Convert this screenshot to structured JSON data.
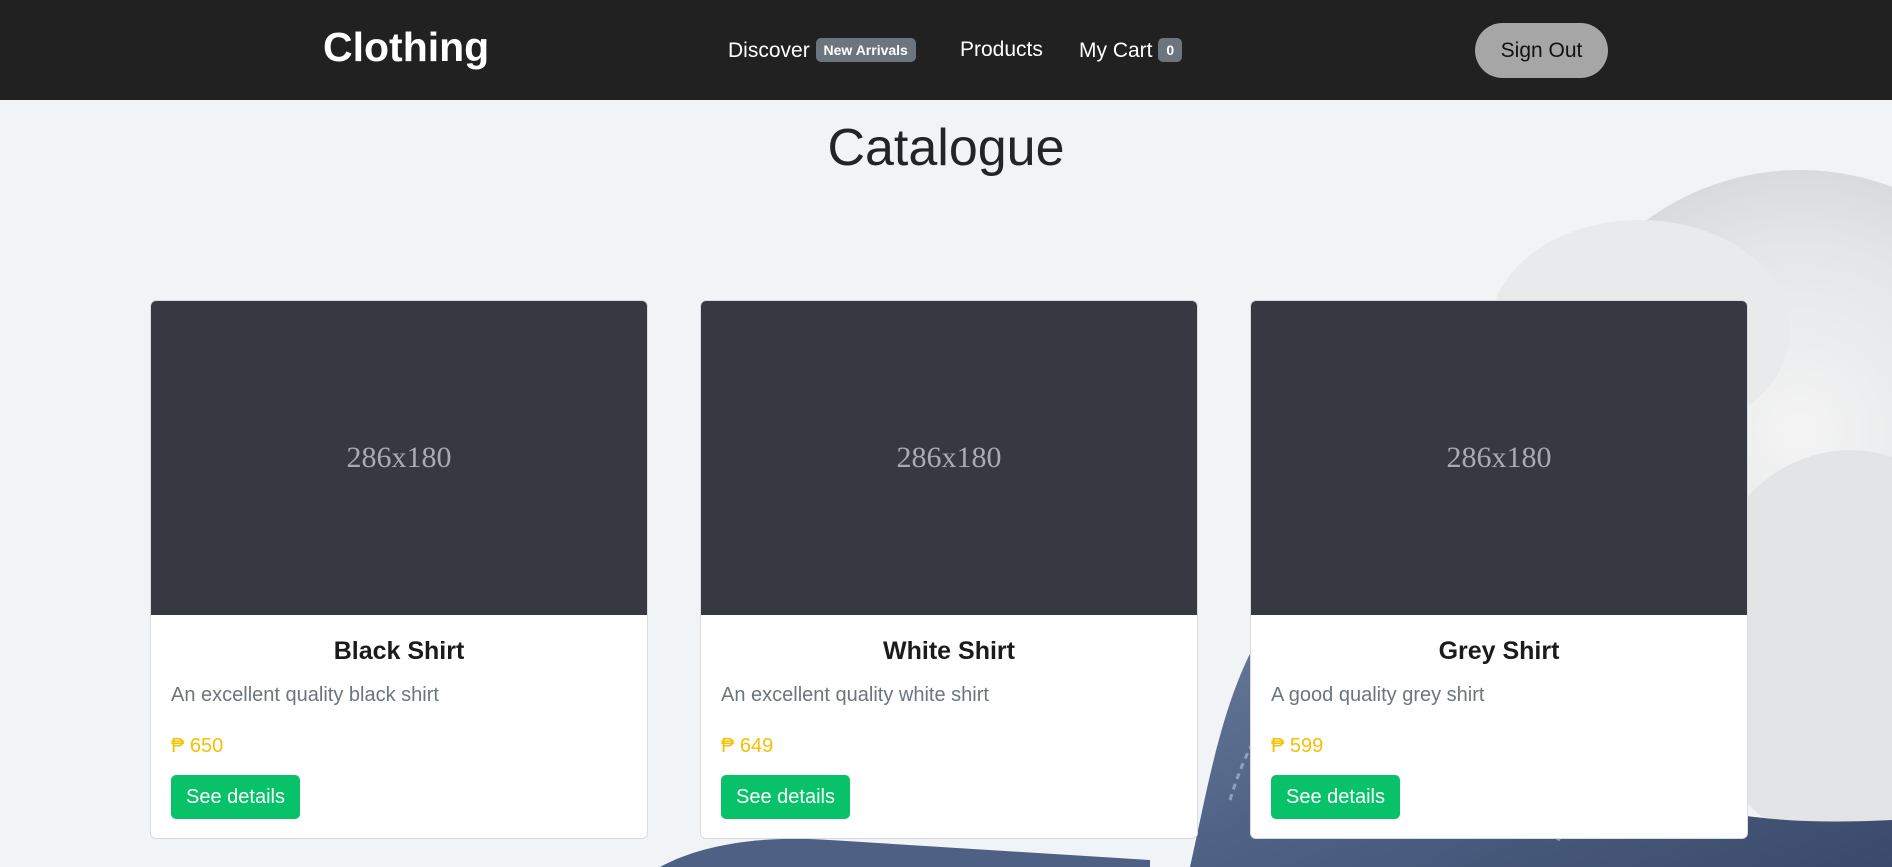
{
  "navbar": {
    "brand": "Clothing",
    "discover_label": "Discover",
    "new_arrivals_badge": "New Arrivals",
    "products_label": "Products",
    "cart_label": "My Cart",
    "cart_count": "0",
    "signout_label": "Sign Out"
  },
  "page": {
    "title": "Catalogue"
  },
  "products": [
    {
      "image_placeholder": "286x180",
      "name": "Black Shirt",
      "description": "An excellent quality black shirt",
      "price": "₱ 650",
      "button_label": "See details"
    },
    {
      "image_placeholder": "286x180",
      "name": "White Shirt",
      "description": "An excellent quality white shirt",
      "price": "₱ 649",
      "button_label": "See details"
    },
    {
      "image_placeholder": "286x180",
      "name": "Grey Shirt",
      "description": "A good quality grey shirt",
      "price": "₱ 599",
      "button_label": "See details"
    }
  ],
  "colors": {
    "navbar_bg": "#212121",
    "price": "#f5c000",
    "button": "#08c26a",
    "badge": "#6c757d",
    "signout_bg": "#a6a6a6"
  }
}
